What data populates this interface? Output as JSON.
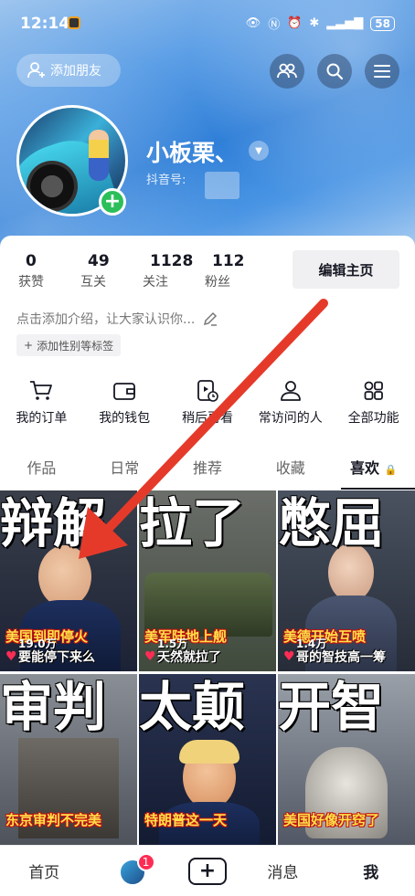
{
  "status_bar": {
    "time": "12:14",
    "battery": "58"
  },
  "header": {
    "add_friend": "添加朋友",
    "nickname": "小板栗、",
    "douyin_id_label": "抖音号:"
  },
  "stats": [
    {
      "value": "0",
      "label": "获赞"
    },
    {
      "value": "49",
      "label": "互关"
    },
    {
      "value": "1128",
      "label": "关注"
    },
    {
      "value": "112",
      "label": "粉丝"
    }
  ],
  "edit_profile": "编辑主页",
  "intro": "点击添加介绍，让大家认识你...",
  "tag_label": "添加性别等标签",
  "functions": [
    {
      "label": "我的订单",
      "icon": "cart-icon"
    },
    {
      "label": "我的钱包",
      "icon": "wallet-icon"
    },
    {
      "label": "稍后再看",
      "icon": "watch-later-icon"
    },
    {
      "label": "常访问的人",
      "icon": "person-icon"
    },
    {
      "label": "全部功能",
      "icon": "grid-icon"
    }
  ],
  "tabs": [
    "作品",
    "日常",
    "推荐",
    "收藏",
    "喜欢"
  ],
  "videos": [
    {
      "big": "辩解",
      "caption": "美国到即停火",
      "sub": "要能停下来么"
    },
    {
      "big": "拉了",
      "caption": "美军陆地上舰",
      "sub": "天然就拉了"
    },
    {
      "big": "憋屈",
      "caption": "美德开始互喷",
      "sub": "哥的智技高一筹"
    },
    {
      "big": "审判",
      "caption": "东京审判不完美",
      "sub": ""
    },
    {
      "big": "太颠",
      "caption": "特朗普这一天",
      "sub": ""
    },
    {
      "big": "开智",
      "caption": "美国好像开窍了",
      "sub": ""
    }
  ],
  "like_counts": [
    "19.0万",
    "1.5万",
    "1.4万"
  ],
  "bottom_nav": {
    "home": "首页",
    "badge": "1",
    "messages": "消息",
    "me": "我"
  }
}
